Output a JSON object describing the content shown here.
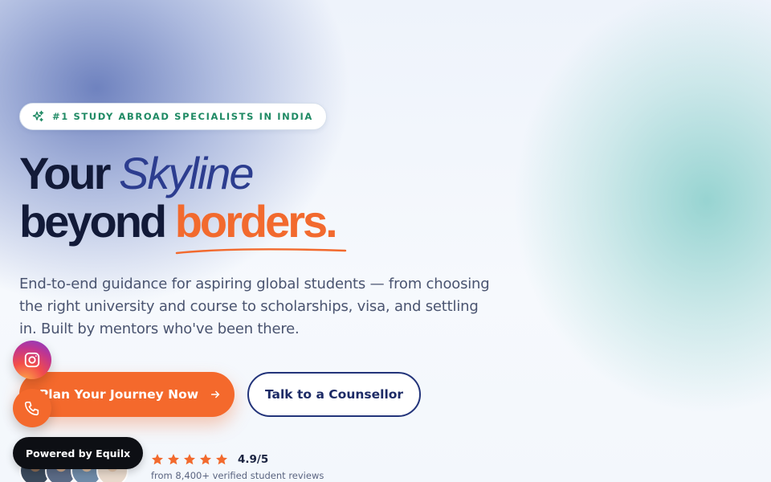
{
  "hero": {
    "badge_text": "#1 STUDY ABROAD SPECIALISTS IN INDIA",
    "badge_icon": "sparkles-icon",
    "headline": {
      "word1": "Your",
      "word2": "Skyline",
      "word3": "beyond",
      "word4": "borders."
    },
    "subtitle": "End-to-end guidance for aspiring global students — from choosing the right university and course to scholarships, visa, and settling in. Built by mentors who've been there.",
    "primary_cta": "Plan Your Journey Now",
    "secondary_cta": "Talk to a Counsellor"
  },
  "social_proof": {
    "rating": "4.9/5",
    "stars": 5,
    "reviews_text": "from 8,400+ verified student reviews",
    "avatar_colors": [
      "#3b4a5c",
      "#5b6b86",
      "#6f8ba8",
      "#e8d9cc"
    ]
  },
  "floating": {
    "instagram_icon": "instagram-icon",
    "phone_icon": "phone-icon",
    "powered_by": "Powered by Equilx"
  },
  "colors": {
    "accent_orange": "#f4692c",
    "navy": "#121a38",
    "indigo": "#2c3d8f",
    "badge_green": "#1f8a64",
    "star_orange": "#f26a2e"
  }
}
